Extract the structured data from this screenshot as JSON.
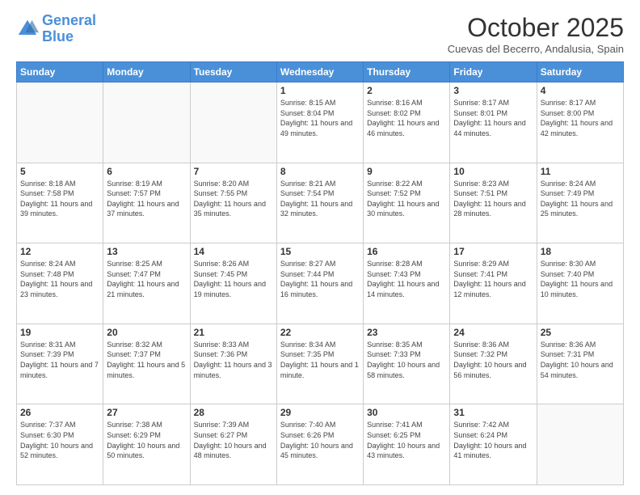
{
  "logo": {
    "line1": "General",
    "line2": "Blue"
  },
  "header": {
    "month": "October 2025",
    "location": "Cuevas del Becerro, Andalusia, Spain"
  },
  "weekdays": [
    "Sunday",
    "Monday",
    "Tuesday",
    "Wednesday",
    "Thursday",
    "Friday",
    "Saturday"
  ],
  "weeks": [
    [
      {
        "day": "",
        "sunrise": "",
        "sunset": "",
        "daylight": ""
      },
      {
        "day": "",
        "sunrise": "",
        "sunset": "",
        "daylight": ""
      },
      {
        "day": "",
        "sunrise": "",
        "sunset": "",
        "daylight": ""
      },
      {
        "day": "1",
        "sunrise": "Sunrise: 8:15 AM",
        "sunset": "Sunset: 8:04 PM",
        "daylight": "Daylight: 11 hours and 49 minutes."
      },
      {
        "day": "2",
        "sunrise": "Sunrise: 8:16 AM",
        "sunset": "Sunset: 8:02 PM",
        "daylight": "Daylight: 11 hours and 46 minutes."
      },
      {
        "day": "3",
        "sunrise": "Sunrise: 8:17 AM",
        "sunset": "Sunset: 8:01 PM",
        "daylight": "Daylight: 11 hours and 44 minutes."
      },
      {
        "day": "4",
        "sunrise": "Sunrise: 8:17 AM",
        "sunset": "Sunset: 8:00 PM",
        "daylight": "Daylight: 11 hours and 42 minutes."
      }
    ],
    [
      {
        "day": "5",
        "sunrise": "Sunrise: 8:18 AM",
        "sunset": "Sunset: 7:58 PM",
        "daylight": "Daylight: 11 hours and 39 minutes."
      },
      {
        "day": "6",
        "sunrise": "Sunrise: 8:19 AM",
        "sunset": "Sunset: 7:57 PM",
        "daylight": "Daylight: 11 hours and 37 minutes."
      },
      {
        "day": "7",
        "sunrise": "Sunrise: 8:20 AM",
        "sunset": "Sunset: 7:55 PM",
        "daylight": "Daylight: 11 hours and 35 minutes."
      },
      {
        "day": "8",
        "sunrise": "Sunrise: 8:21 AM",
        "sunset": "Sunset: 7:54 PM",
        "daylight": "Daylight: 11 hours and 32 minutes."
      },
      {
        "day": "9",
        "sunrise": "Sunrise: 8:22 AM",
        "sunset": "Sunset: 7:52 PM",
        "daylight": "Daylight: 11 hours and 30 minutes."
      },
      {
        "day": "10",
        "sunrise": "Sunrise: 8:23 AM",
        "sunset": "Sunset: 7:51 PM",
        "daylight": "Daylight: 11 hours and 28 minutes."
      },
      {
        "day": "11",
        "sunrise": "Sunrise: 8:24 AM",
        "sunset": "Sunset: 7:49 PM",
        "daylight": "Daylight: 11 hours and 25 minutes."
      }
    ],
    [
      {
        "day": "12",
        "sunrise": "Sunrise: 8:24 AM",
        "sunset": "Sunset: 7:48 PM",
        "daylight": "Daylight: 11 hours and 23 minutes."
      },
      {
        "day": "13",
        "sunrise": "Sunrise: 8:25 AM",
        "sunset": "Sunset: 7:47 PM",
        "daylight": "Daylight: 11 hours and 21 minutes."
      },
      {
        "day": "14",
        "sunrise": "Sunrise: 8:26 AM",
        "sunset": "Sunset: 7:45 PM",
        "daylight": "Daylight: 11 hours and 19 minutes."
      },
      {
        "day": "15",
        "sunrise": "Sunrise: 8:27 AM",
        "sunset": "Sunset: 7:44 PM",
        "daylight": "Daylight: 11 hours and 16 minutes."
      },
      {
        "day": "16",
        "sunrise": "Sunrise: 8:28 AM",
        "sunset": "Sunset: 7:43 PM",
        "daylight": "Daylight: 11 hours and 14 minutes."
      },
      {
        "day": "17",
        "sunrise": "Sunrise: 8:29 AM",
        "sunset": "Sunset: 7:41 PM",
        "daylight": "Daylight: 11 hours and 12 minutes."
      },
      {
        "day": "18",
        "sunrise": "Sunrise: 8:30 AM",
        "sunset": "Sunset: 7:40 PM",
        "daylight": "Daylight: 11 hours and 10 minutes."
      }
    ],
    [
      {
        "day": "19",
        "sunrise": "Sunrise: 8:31 AM",
        "sunset": "Sunset: 7:39 PM",
        "daylight": "Daylight: 11 hours and 7 minutes."
      },
      {
        "day": "20",
        "sunrise": "Sunrise: 8:32 AM",
        "sunset": "Sunset: 7:37 PM",
        "daylight": "Daylight: 11 hours and 5 minutes."
      },
      {
        "day": "21",
        "sunrise": "Sunrise: 8:33 AM",
        "sunset": "Sunset: 7:36 PM",
        "daylight": "Daylight: 11 hours and 3 minutes."
      },
      {
        "day": "22",
        "sunrise": "Sunrise: 8:34 AM",
        "sunset": "Sunset: 7:35 PM",
        "daylight": "Daylight: 11 hours and 1 minute."
      },
      {
        "day": "23",
        "sunrise": "Sunrise: 8:35 AM",
        "sunset": "Sunset: 7:33 PM",
        "daylight": "Daylight: 10 hours and 58 minutes."
      },
      {
        "day": "24",
        "sunrise": "Sunrise: 8:36 AM",
        "sunset": "Sunset: 7:32 PM",
        "daylight": "Daylight: 10 hours and 56 minutes."
      },
      {
        "day": "25",
        "sunrise": "Sunrise: 8:36 AM",
        "sunset": "Sunset: 7:31 PM",
        "daylight": "Daylight: 10 hours and 54 minutes."
      }
    ],
    [
      {
        "day": "26",
        "sunrise": "Sunrise: 7:37 AM",
        "sunset": "Sunset: 6:30 PM",
        "daylight": "Daylight: 10 hours and 52 minutes."
      },
      {
        "day": "27",
        "sunrise": "Sunrise: 7:38 AM",
        "sunset": "Sunset: 6:29 PM",
        "daylight": "Daylight: 10 hours and 50 minutes."
      },
      {
        "day": "28",
        "sunrise": "Sunrise: 7:39 AM",
        "sunset": "Sunset: 6:27 PM",
        "daylight": "Daylight: 10 hours and 48 minutes."
      },
      {
        "day": "29",
        "sunrise": "Sunrise: 7:40 AM",
        "sunset": "Sunset: 6:26 PM",
        "daylight": "Daylight: 10 hours and 45 minutes."
      },
      {
        "day": "30",
        "sunrise": "Sunrise: 7:41 AM",
        "sunset": "Sunset: 6:25 PM",
        "daylight": "Daylight: 10 hours and 43 minutes."
      },
      {
        "day": "31",
        "sunrise": "Sunrise: 7:42 AM",
        "sunset": "Sunset: 6:24 PM",
        "daylight": "Daylight: 10 hours and 41 minutes."
      },
      {
        "day": "",
        "sunrise": "",
        "sunset": "",
        "daylight": ""
      }
    ]
  ]
}
